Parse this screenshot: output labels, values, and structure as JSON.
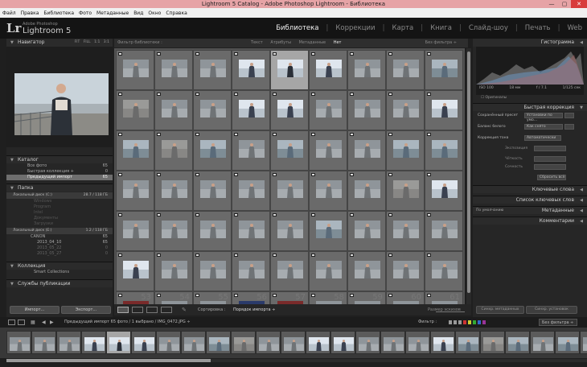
{
  "window": {
    "title": "Lightroom 5 Catalog - Adobe Photoshop Lightroom - Библиотека",
    "minimize": "—",
    "maximize": "▢",
    "close": "✕"
  },
  "menu": [
    "Файл",
    "Правка",
    "Библиотека",
    "Фото",
    "Метаданные",
    "Вид",
    "Окно",
    "Справка"
  ],
  "identity": {
    "logo": "Lr",
    "adobe": "Adobe Photoshop",
    "product": "Lightroom 5"
  },
  "modules": [
    {
      "label": "Библиотека",
      "active": true
    },
    {
      "label": "Коррекции"
    },
    {
      "label": "Карта"
    },
    {
      "label": "Книга"
    },
    {
      "label": "Слайд-шоу"
    },
    {
      "label": "Печать"
    },
    {
      "label": "Web"
    }
  ],
  "navigator": {
    "title": "Навигатор",
    "zoom": [
      "FIT",
      "FILL",
      "1:1",
      "3:1"
    ]
  },
  "catalog": {
    "title": "Каталог",
    "items": [
      {
        "label": "Все фото",
        "count": "65"
      },
      {
        "label": "Быстрая коллекция +",
        "count": "0"
      },
      {
        "label": "Предыдущий импорт",
        "count": "65",
        "selected": true
      }
    ]
  },
  "folders": {
    "title": "Папка",
    "disk1": {
      "label": "Локальный диск (C:)",
      "size": "28.7 / 118 ГБ"
    },
    "disk1_items": [
      "Windows",
      "Program",
      "Intel",
      "Документы",
      "Загрузки"
    ],
    "disk2": {
      "label": "Локальный диск (E:)",
      "size": "1.2 / 118 ГБ"
    },
    "disk2_items": [
      {
        "label": "CANON",
        "count": "65"
      },
      {
        "label": "2013_04_10",
        "count": "65"
      },
      {
        "label": "2013_05_22",
        "count": "0"
      },
      {
        "label": "2013_05_27",
        "count": "0"
      }
    ]
  },
  "collections": {
    "title": "Коллекция",
    "smart": "Smart Collections"
  },
  "publish": {
    "title": "Службы публикации"
  },
  "left_buttons": {
    "import": "Импорт...",
    "export": "Экспорт..."
  },
  "filterbar": {
    "title": "Фильтр библиотеки :",
    "options": [
      "Текст",
      "Атрибуты",
      "Метаданные",
      "Нет"
    ],
    "active": "Нет",
    "preset": "Без фильтра ÷"
  },
  "toolbar": {
    "sort_label": "Сортировка :",
    "sort_value": "Порядок импорта ÷",
    "thumbs": "Размер эскизов"
  },
  "histogram": {
    "title": "Гистограмма",
    "iso": "ISO 100",
    "focal": "18 мм",
    "aperture": "f / 7.1",
    "shutter": "1/125 сек",
    "original": "Оригиналы"
  },
  "quick_develop": {
    "title": "Быстрая коррекция",
    "saved_label": "Сохранённый пресет",
    "saved_value": "Установки по умо...",
    "wb_label": "Баланс белого",
    "wb_value": "Как снято",
    "tone_label": "Коррекция тона",
    "auto_button": "Автоматически",
    "exposure": "Экспозиция",
    "clarity": "Чёткость",
    "vibrance": "Сочность",
    "reset": "Сбросить всё"
  },
  "keywording": {
    "title": "Ключевые слова"
  },
  "keyword_list": {
    "title": "Список ключевых слов"
  },
  "metadata": {
    "title": "Метаданные",
    "preset": "По умолчанию"
  },
  "comments": {
    "title": "Комментарии"
  },
  "sync": {
    "metadata": "Синхр. метаданных",
    "settings": "Синхр. установок"
  },
  "filmstrip": {
    "info": "Предыдущий импорт  65 фото / 1 выбрано / IMG_0472.JPG ÷",
    "filter_label": "Фильтр :",
    "filter_value": "Без фильтра ÷"
  },
  "grid_thumbs": [
    "p",
    "p",
    "p",
    "w",
    "s",
    "w",
    "p",
    "p",
    "c",
    "g",
    "p",
    "p",
    "w",
    "w",
    "p",
    "p",
    "p",
    "w",
    "c",
    "g",
    "c",
    "p",
    "c",
    "p",
    "p",
    "c",
    "c",
    "p",
    "p",
    "p",
    "p",
    "p",
    "p",
    "p",
    "g",
    "w",
    "p",
    "p",
    "p",
    "p",
    "p",
    "c",
    "p",
    "p",
    "p",
    "w",
    "p",
    "p",
    "p",
    "p",
    "p",
    "p",
    "p",
    "p",
    "r",
    "p",
    "p",
    "b",
    "r",
    "p",
    "p",
    "p",
    "p"
  ],
  "grid_numbers": [
    "53",
    "54",
    "55",
    "56",
    "57",
    "58",
    "59",
    "60",
    "61",
    "62"
  ],
  "film_thumbs": [
    "p",
    "p",
    "p",
    "w",
    "s",
    "w",
    "p",
    "p",
    "c",
    "g",
    "p",
    "p",
    "w",
    "w",
    "p",
    "p",
    "p",
    "w",
    "c",
    "g",
    "c",
    "p",
    "c",
    "p"
  ],
  "colors": {
    "accent_sel": "#a6a6a6",
    "panel": "#262626",
    "grid": "#525252"
  }
}
